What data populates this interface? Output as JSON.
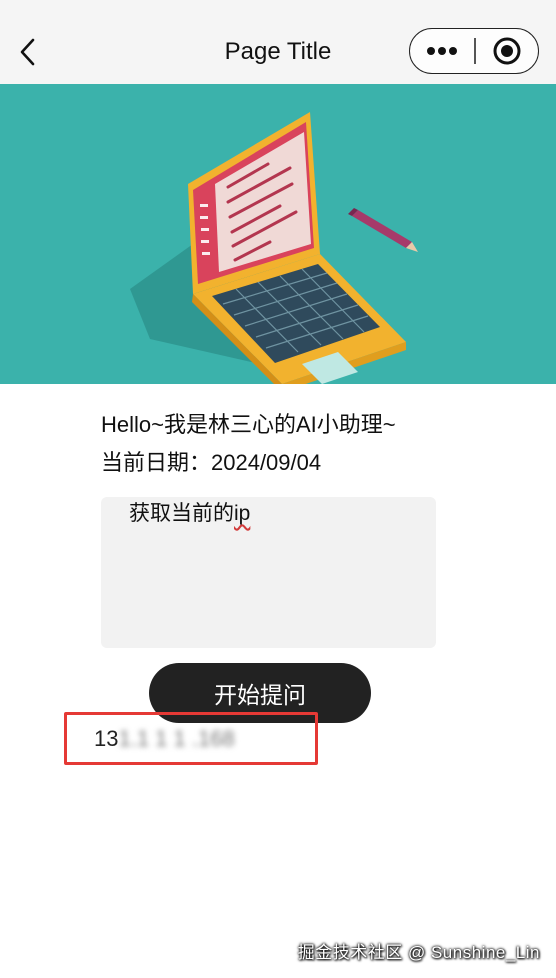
{
  "nav": {
    "title": "Page Title",
    "back_icon": "chevron-left-icon",
    "more_icon": "more-dots-icon",
    "close_icon": "target-circle-icon"
  },
  "banner": {
    "background_color": "#3bb2ab",
    "illustration": "laptop-illustration"
  },
  "content": {
    "greeting": "Hello~我是林三心的AI小助理~",
    "date_line": "当前日期：2024/09/04",
    "question_prefix": "获取当前的",
    "question_suffix": "ip",
    "ask_button_label": "开始提问",
    "result_visible": "13",
    "result_blurred": "1.1 1  1  .168"
  },
  "colors": {
    "accent_button": "#222222",
    "highlight_border": "#e53935"
  },
  "watermark": "掘金技术社区 @ Sunshine_Lin"
}
